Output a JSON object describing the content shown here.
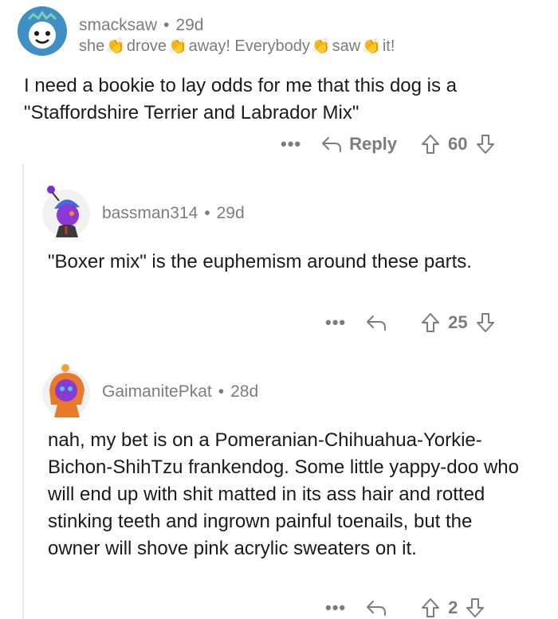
{
  "comments": [
    {
      "username": "smacksaw",
      "age": "29d",
      "flair": [
        "she",
        "drove",
        "away! Everybody",
        "saw",
        "it!"
      ],
      "text": "I need a bookie to lay odds for me that this dog is a \"Staffordshire Terrier and Labrador Mix\"",
      "reply_label": "Reply",
      "votes": "60"
    },
    {
      "username": "bassman314",
      "age": "29d",
      "text": "\"Boxer mix\" is the euphemism around these parts.",
      "votes": "25"
    },
    {
      "username": "GaimanitePkat",
      "age": "28d",
      "text": "nah, my bet is on a Pomeranian-Chihuahua-Yorkie-Bichon-ShihTzu frankendog. Some little yappy-doo who will end up with shit matted in its ass hair and rotted stinking teeth and ingrown painful toenails, but the owner will shove pink acrylic sweaters on it.",
      "votes": "2"
    }
  ],
  "ui": {
    "more_glyph": "•••",
    "separator": "•",
    "icons": [
      "clap-icon",
      "reply-arrow-icon",
      "upvote-icon",
      "downvote-icon",
      "more-options-icon"
    ]
  }
}
